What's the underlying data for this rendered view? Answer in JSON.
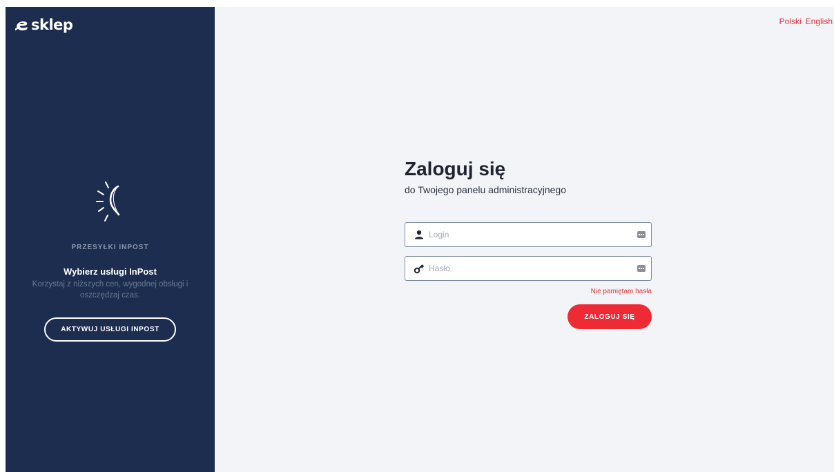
{
  "sidebar": {
    "logo_text": "sklep",
    "promo": {
      "eyebrow": "PRZESYŁKI INPOST",
      "title": "Wybierz usługi InPost",
      "description": "Korzystaj z niższych cen, wygodnej obsługi i oszczędzaj czas.",
      "button_label": "AKTYWUJ USŁUGI INPOST"
    }
  },
  "header": {
    "languages": [
      "Polski",
      "English"
    ]
  },
  "login": {
    "title": "Zaloguj się",
    "subtitle": "do Twojego panelu administracyjnego",
    "login_placeholder": "Login",
    "login_value": "",
    "password_placeholder": "Hasło",
    "password_value": "",
    "forgot_label": "Nie pamiętam hasła",
    "submit_label": "ZALOGUJ SIĘ"
  },
  "icons": {
    "logo": "esklep-logo-icon",
    "promo": "inpost-sun-icon",
    "login_field": "user-icon",
    "password_field": "key-icon",
    "autofill": "password-manager-icon"
  },
  "colors": {
    "sidebar_bg": "#1c2d4f",
    "accent": "#ee2b35",
    "page_bg": "#f3f4f7"
  }
}
